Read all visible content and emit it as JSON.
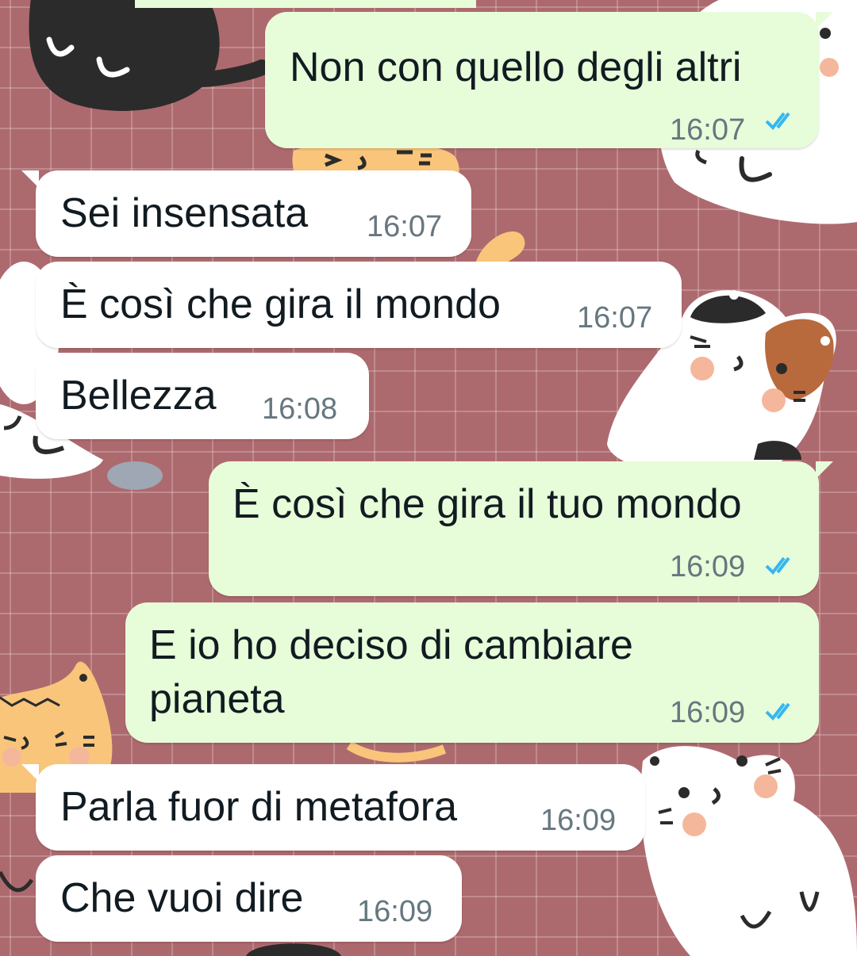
{
  "colors": {
    "wallpaper": "#ad6a6e",
    "incoming_bubble": "#ffffff",
    "outgoing_bubble": "#e7fcd9",
    "timestamp": "#66777f",
    "read_ticks": "#34b7f1"
  },
  "messages": [
    {
      "direction": "outgoing",
      "text": "Non con quello degli altri",
      "time": "16:07",
      "status": "read"
    },
    {
      "direction": "incoming",
      "text": "Sei insensata",
      "time": "16:07"
    },
    {
      "direction": "incoming",
      "text": "È così che gira il mondo",
      "time": "16:07"
    },
    {
      "direction": "incoming",
      "text": "Bellezza",
      "time": "16:08"
    },
    {
      "direction": "outgoing",
      "text": "È così che gira il tuo mondo",
      "time": "16:09",
      "status": "read"
    },
    {
      "direction": "outgoing",
      "text": "E io ho deciso di cambiare\npianeta",
      "time": "16:09",
      "status": "read"
    },
    {
      "direction": "incoming",
      "text": "Parla fuor di metafora",
      "time": "16:09"
    },
    {
      "direction": "incoming",
      "text": "Che vuoi dire",
      "time": "16:09"
    }
  ],
  "icons": {
    "read_status": "double-check-icon",
    "wallpaper": "cat-pattern-wallpaper"
  }
}
